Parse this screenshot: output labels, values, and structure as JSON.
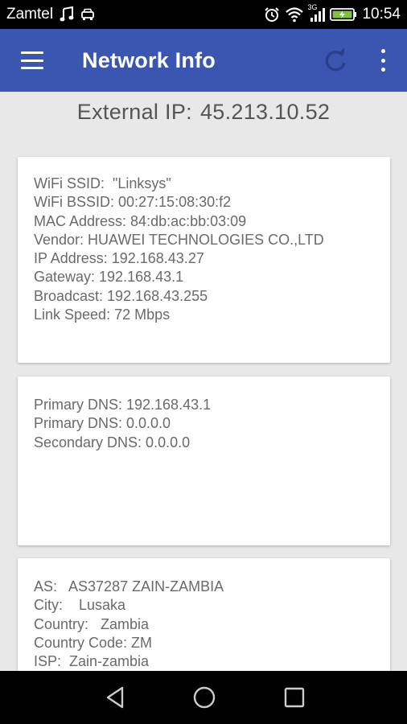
{
  "status_bar": {
    "carrier": "Zamtel",
    "network_type": "3G",
    "time": "10:54",
    "icons": [
      "music-note-icon",
      "car-icon",
      "alarm-icon",
      "wifi-icon",
      "signal-icon",
      "battery-icon"
    ]
  },
  "app_bar": {
    "title": "Network Info",
    "color": "#3a56b0"
  },
  "external_ip": {
    "label": "External IP:",
    "value": "45.213.10.52"
  },
  "wifi_card": {
    "rows": [
      "WiFi SSID:  \"Linksys\"",
      "WiFi BSSID: 00:27:15:08:30:f2",
      "MAC Address: 84:db:ac:bb:03:09",
      "Vendor: HUAWEI TECHNOLOGIES CO.,LTD",
      "IP Address: 192.168.43.27",
      "Gateway: 192.168.43.1",
      "Broadcast: 192.168.43.255",
      "Link Speed: 72 Mbps"
    ]
  },
  "dns_card": {
    "rows": [
      "Primary DNS: 192.168.43.1",
      "Primary DNS: 0.0.0.0",
      "Secondary DNS: 0.0.0.0"
    ]
  },
  "isp_card": {
    "rows": [
      "AS:   AS37287 ZAIN-ZAMBIA",
      "City:    Lusaka",
      "Country:   Zambia",
      "Country Code: ZM",
      "ISP:  Zain-zambia"
    ]
  }
}
